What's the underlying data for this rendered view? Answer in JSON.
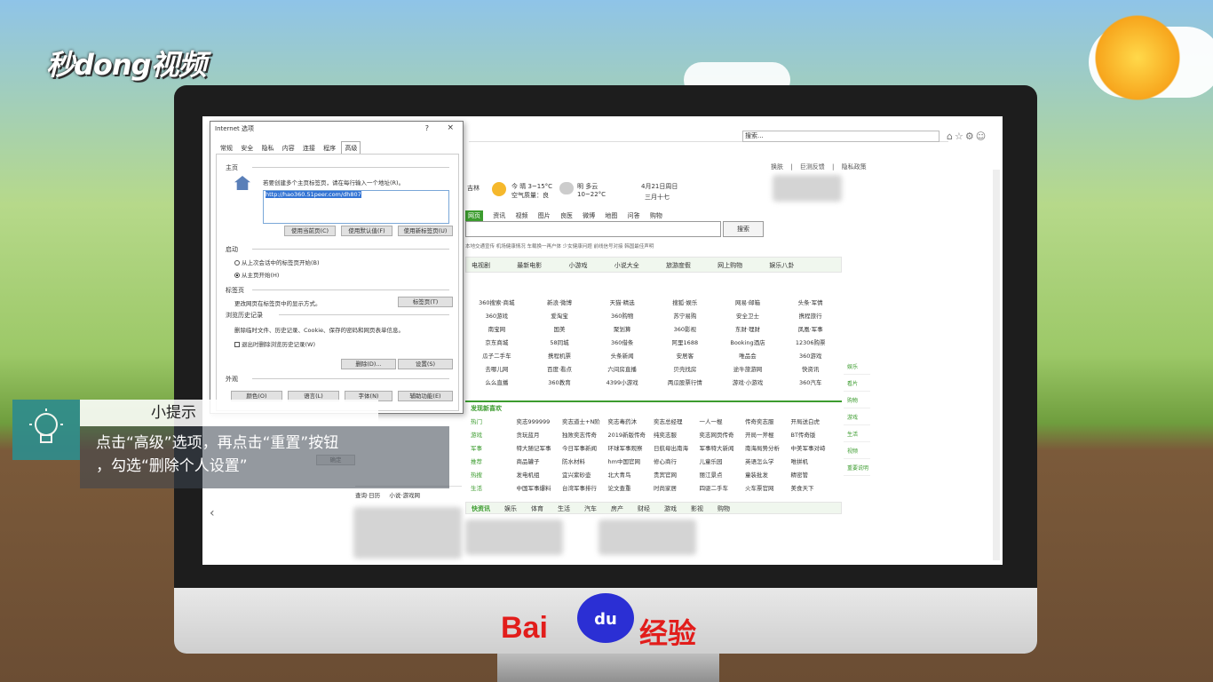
{
  "watermark_logo": "秒dong视频",
  "brand": {
    "baidu": "Bai",
    "du": "du",
    "jingyan": "经验"
  },
  "browser": {
    "search_placeholder": "搜索...",
    "top_links": "换肤 | 巨测反馈 | 隐私政策",
    "city": "吉林",
    "weather_today": "今 晴 3~15°C",
    "weather_tomorrow": "明 多云 10~22°C",
    "air": "空气质量：良",
    "date": "4月21日周日",
    "lunar": "三月十七",
    "search_button": "搜索",
    "tabs": [
      "网页",
      "资讯",
      "视频",
      "图片",
      "良医",
      "微博",
      "地图",
      "问答",
      "购物"
    ],
    "hot_words": "本地交通宣传   机场健康情况   车载换一再户体   少女健康问题   前线信号对接   韩国最佳声明",
    "channels": [
      "电视剧",
      "最新电影",
      "小游戏",
      "小说大全",
      "旅游度假",
      "网上购物",
      "娱乐八卦"
    ],
    "sites": [
      "360搜索·商城",
      "新浪·微博",
      "天猫·精选",
      "搜狐·娱乐",
      "网易·邮箱",
      "头条·军情",
      "360游戏",
      "爱淘宝",
      "360购物",
      "苏宁易购",
      "安全卫士",
      "携程旅行",
      "南宝网",
      "国美",
      "聚划算",
      "360影视",
      "东财·理财",
      "凤凰·军事",
      "京东商城",
      "58同城",
      "360借条",
      "阿里1688",
      "Booking酒店",
      "12306购票",
      "瓜子二手车",
      "携程机票",
      "头条新闻",
      "安居客",
      "唯品会",
      "360游戏",
      "去哪儿网",
      "百度·看点",
      "六间房直播",
      "贝壳找房",
      "途牛旅游网",
      "快资讯",
      "么么直播",
      "360教育",
      "4399小游戏",
      "两瓜股票行情",
      "游戏·小游戏",
      "360汽车"
    ],
    "news_header": "发现新喜欢",
    "news_rows": [
      [
        "热门",
        "奕志999999",
        "奕志道士+N阶",
        "奕志毒药沐",
        "奕志总经理",
        "一人一棍",
        "传奇奕志服",
        "开局送白虎"
      ],
      [
        "游戏",
        "贪玩蓝月",
        "独败奕志传奇",
        "2019新版传奇",
        "纯奕志服",
        "奕志网页传奇",
        "开局一斧棍",
        "BT传奇版"
      ],
      [
        "军事",
        "特大随记军事",
        "今日军事新闻",
        "环球军事观察",
        "日航母出南海",
        "军事特大新闻",
        "南海局势分析",
        "中美军事对峙"
      ],
      [
        "推荐",
        "商品罐子",
        "防水材料",
        "hm中国官网",
        "修心商行",
        "儿童乐园",
        "英语怎么学",
        "唯拼机"
      ],
      [
        "热搜",
        "发电机组",
        "宜兴紫砂壶",
        "北大青鸟",
        "贵宾官网",
        "丽江景点",
        "童装批发",
        "精密管"
      ],
      [
        "生活",
        "中国军事爆料",
        "台湾军事排行",
        "论文查重",
        "时尚家居",
        "四驱二手车",
        "火车票官网",
        "美食天下"
      ]
    ],
    "feed_tabs": [
      "快资讯",
      "娱乐",
      "体育",
      "生活",
      "汽车",
      "房产",
      "财经",
      "游戏",
      "影视",
      "购物"
    ],
    "side_buttons": [
      "娱乐",
      "看片",
      "购物",
      "游戏",
      "生活",
      "视频",
      "重要说明"
    ],
    "bottom_left_a": "查询·日历",
    "bottom_left_b": "小说·游戏网"
  },
  "dialog": {
    "title": "Internet 选项",
    "help": "?",
    "close": "×",
    "tabs": [
      "常规",
      "安全",
      "隐私",
      "内容",
      "连接",
      "程序",
      "高级"
    ],
    "home_section": "主页",
    "home_desc": "若要创建多个主页标签页，请在每行输入一个地址(R)。",
    "home_url": "http://hao360.51peer.com/dh807",
    "btn_current": "使用当前页(C)",
    "btn_default": "使用默认值(F)",
    "btn_newtab": "使用新标签页(U)",
    "startup_section": "启动",
    "radio_last": "从上次会话中的标签页开始(B)",
    "radio_home": "从主页开始(H)",
    "tabs_section": "标签页",
    "tabs_desc": "更改网页在标签页中的显示方式。",
    "btn_tabs": "标签页(T)",
    "history_section": "浏览历史记录",
    "history_desc": "删除临时文件、历史记录、Cookie、保存的密码和网页表单信息。",
    "history_check": "退出时删除浏览历史记录(W)",
    "btn_delete": "删除(D)...",
    "btn_settings": "设置(S)",
    "appearance_section": "外观",
    "btn_colors": "颜色(O)",
    "btn_languages": "语言(L)",
    "btn_fonts": "字体(N)",
    "btn_access": "辅助功能(E)",
    "btn_ok": "确定"
  },
  "tip": {
    "title": "小提示",
    "line1": "点击“高级”选项，再点击“重置”按钮",
    "line2": "，勾选“删除个人设置”"
  },
  "colors": {
    "accent_green": "#3c9c2f",
    "tip_teal": "#2f8c8c",
    "baidu_red": "#e21d1b",
    "baidu_blue": "#2b2fd4"
  }
}
